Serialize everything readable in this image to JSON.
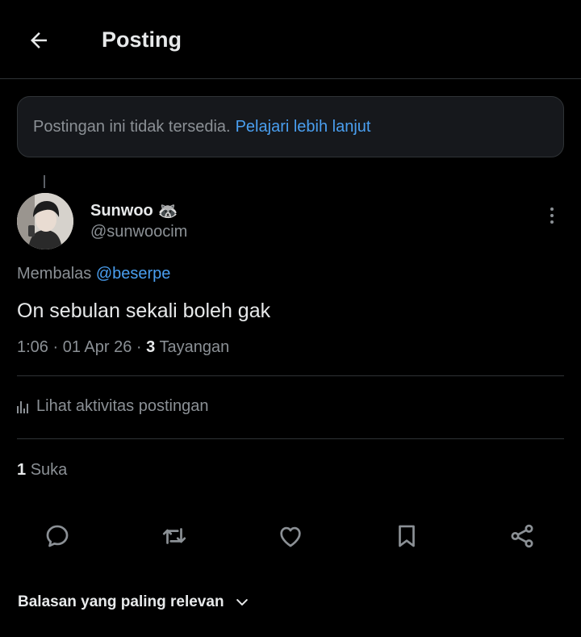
{
  "header": {
    "title": "Posting"
  },
  "notice": {
    "text": "Postingan ini tidak tersedia.",
    "link": "Pelajari lebih lanjut"
  },
  "post": {
    "display_name": "Sunwoo",
    "emoji": "🦝",
    "handle": "@sunwoocim",
    "replying_prefix": "Membalas",
    "replying_to": "@beserpe",
    "text": "On sebulan sekali boleh gak",
    "time": "1:06",
    "date": "01 Apr 26",
    "views_count": "3",
    "views_label": "Tayangan",
    "activity_label": "Lihat aktivitas postingan",
    "likes_count": "1",
    "likes_label": "Suka"
  },
  "actions": {
    "icons": [
      "reply-icon",
      "repost-icon",
      "like-icon",
      "bookmark-icon",
      "share-icon"
    ]
  },
  "sort": {
    "label": "Balasan yang paling relevan"
  },
  "colors": {
    "background": "#000000",
    "text": "#e7e9ea",
    "muted": "#8b9095",
    "link": "#4a9ff0",
    "divider": "#2f3336"
  }
}
